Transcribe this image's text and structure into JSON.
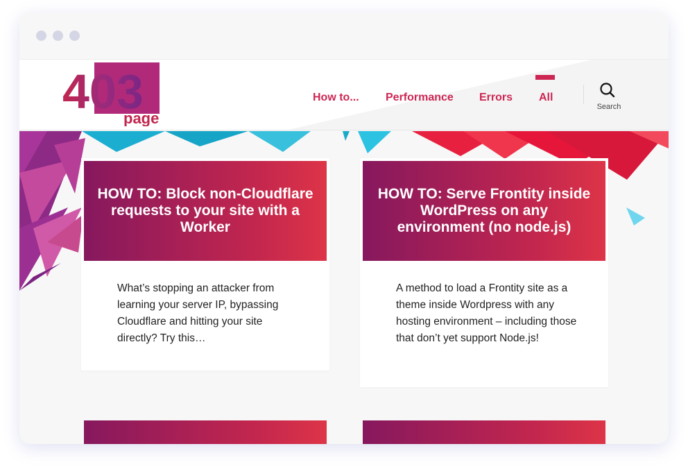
{
  "site": {
    "logo_text_big": "403",
    "logo_text_small": "page"
  },
  "nav": {
    "items": [
      {
        "label": "How to..."
      },
      {
        "label": "Performance"
      },
      {
        "label": "Errors"
      },
      {
        "label": "All",
        "active": true
      }
    ],
    "search_label": "Search"
  },
  "colors": {
    "accent": "#cd2653",
    "card_gradient_start": "#86185e",
    "card_gradient_end": "#dd3448",
    "hero_cyan": "#1fb6d6",
    "hero_red": "#e8203f"
  },
  "posts": [
    {
      "title": "HOW TO: Block non-Cloudflare requests to your site with a Worker",
      "excerpt": "What’s stopping an attacker from learning your server IP, bypassing Cloudflare and hitting your site directly? Try this…"
    },
    {
      "title": "HOW TO: Serve Frontity inside WordPress on any environment (no node.js)",
      "excerpt": "A method to load a Frontity site as a theme inside Wordpress with any hosting environment – including those that don’t yet support Node.js!"
    }
  ]
}
